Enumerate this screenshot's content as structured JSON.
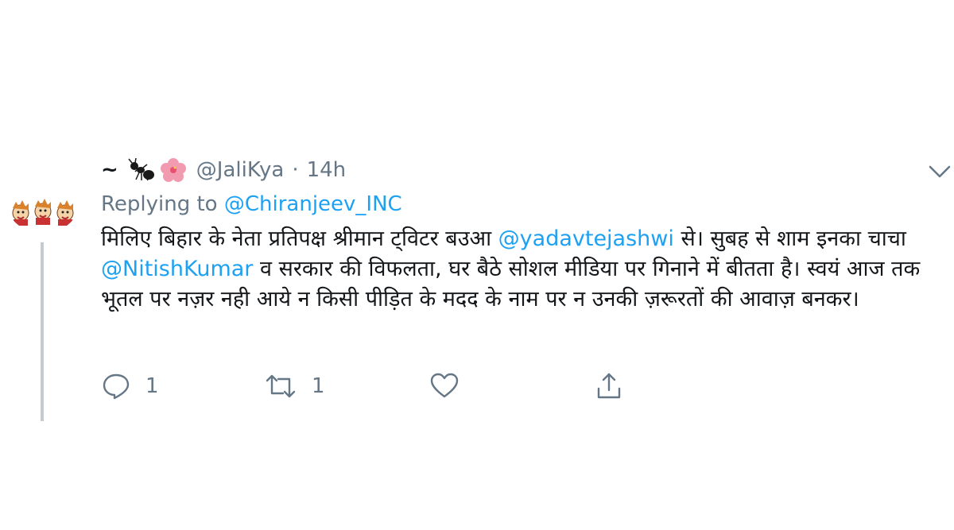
{
  "tweet": {
    "display_name": "~",
    "handle": "@JaliKya",
    "separator": "·",
    "time": "14h",
    "replying_label": "Replying to",
    "replying_to": "@Chiranjeev_INC",
    "body": {
      "part1": "मिलिए बिहार के नेता प्रतिपक्ष श्रीमान ट्विटर बउआ ",
      "mention1": "@yadavtejashwi",
      "part2": " से। सुबह से शाम इनका चाचा ",
      "mention2": "@NitishKumar",
      "part3": " व सरकार की विफलता, घर बैठे सोशल मीडिया पर गिनाने में बीतता है। स्वयं आज तक भूतल पर नज़र नही आये न किसी पीड़ित के मदद के नाम पर न उनकी ज़रूरतों की आवाज़ बनकर।"
    },
    "actions": {
      "reply_count": "1",
      "retweet_count": "1"
    }
  },
  "colors": {
    "link": "#1da1f2",
    "muted": "#657786",
    "text": "#14171a",
    "thread_line": "#c4ccd2"
  },
  "icons": [
    "avatar",
    "ant-emoji-icon",
    "hibiscus-emoji-icon",
    "chevron-down-icon",
    "reply-icon",
    "retweet-icon",
    "like-icon",
    "share-icon"
  ]
}
